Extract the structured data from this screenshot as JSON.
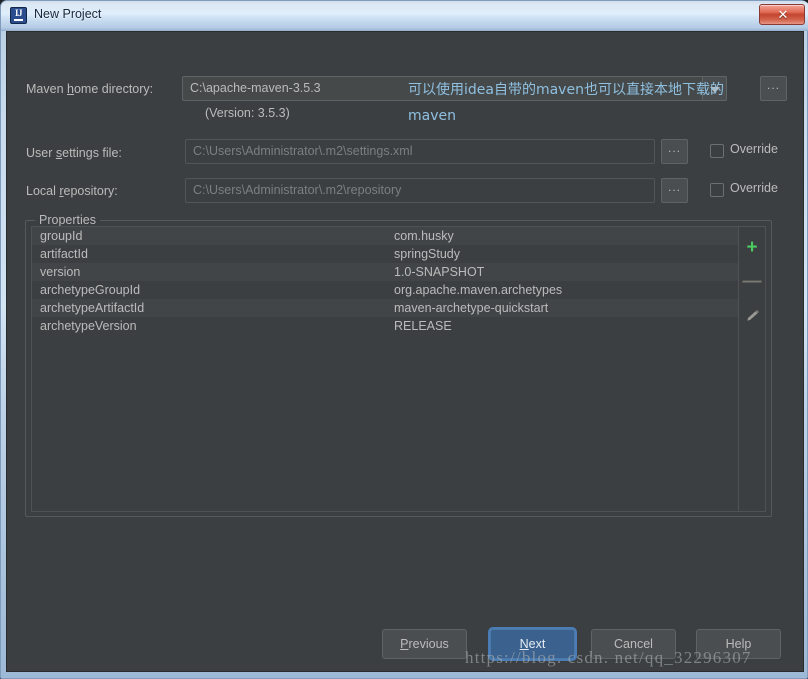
{
  "window": {
    "title": "New Project",
    "app_icon": "intellij-idea-icon",
    "close_label": "✕"
  },
  "form": {
    "maven_home": {
      "label_pre": "Maven ",
      "label_mnemonic": "h",
      "label_post": "ome directory:",
      "value": "C:\\apache-maven-3.5.3",
      "version_note": "(Version: 3.5.3)",
      "browse_label": "..."
    },
    "user_settings": {
      "label_pre": "User ",
      "label_mnemonic": "s",
      "label_post": "ettings file:",
      "value": "C:\\Users\\Administrator\\.m2\\settings.xml",
      "browse_label": "...",
      "override_label": "Override",
      "override_checked": false
    },
    "local_repository": {
      "label_pre": "Local ",
      "label_mnemonic": "r",
      "label_post": "epository:",
      "value": "C:\\Users\\Administrator\\.m2\\repository",
      "browse_label": "...",
      "override_label": "Override",
      "override_checked": false
    }
  },
  "annotation": {
    "text": "可以使用idea自带的maven也可以直接本地下载的maven",
    "color": "#8fc0e0"
  },
  "properties": {
    "legend": "Properties",
    "rows": [
      {
        "key": "groupId",
        "value": "com.husky"
      },
      {
        "key": "artifactId",
        "value": "springStudy"
      },
      {
        "key": "version",
        "value": "1.0-SNAPSHOT"
      },
      {
        "key": "archetypeGroupId",
        "value": "org.apache.maven.archetypes"
      },
      {
        "key": "archetypeArtifactId",
        "value": "maven-archetype-quickstart"
      },
      {
        "key": "archetypeVersion",
        "value": "RELEASE"
      }
    ],
    "toolbar": {
      "add": "+",
      "add_color": "#4aca5f",
      "remove": "—",
      "edit": "pencil-icon"
    }
  },
  "buttons": {
    "previous": {
      "pre": "",
      "mnemonic": "P",
      "post": "revious"
    },
    "next": {
      "pre": "",
      "mnemonic": "N",
      "post": "ext"
    },
    "cancel": {
      "label": "Cancel"
    },
    "help": {
      "label": "Help"
    }
  },
  "watermark": {
    "text": "https://blog. csdn. net/qq_32296307"
  }
}
